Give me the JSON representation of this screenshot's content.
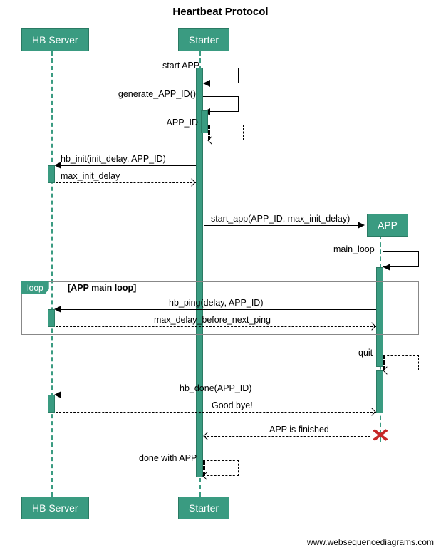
{
  "title": "Heartbeat Protocol",
  "actors": {
    "hb_server": "HB Server",
    "starter": "Starter",
    "app": "APP"
  },
  "messages": {
    "start_app_self": "start APP",
    "generate_id": "generate_APP_ID()",
    "app_id": "APP_ID",
    "hb_init": "hb_init(init_delay, APP_ID)",
    "max_init_delay": "max_init_delay",
    "start_app_call": "start_app(APP_ID, max_init_delay)",
    "main_loop": "main_loop",
    "hb_ping": "hb_ping(delay, APP_ID)",
    "max_delay_next": "max_delay_before_next_ping",
    "quit": "quit",
    "hb_done": "hb_done(APP_ID)",
    "good_bye": "Good bye!",
    "app_finished": "APP is finished",
    "done_with_app": "done with APP"
  },
  "loop": {
    "tag": "loop",
    "label": "[APP main loop]"
  },
  "footer": "www.websequencediagrams.com",
  "colors": {
    "actor_bg": "#3a9b81"
  }
}
